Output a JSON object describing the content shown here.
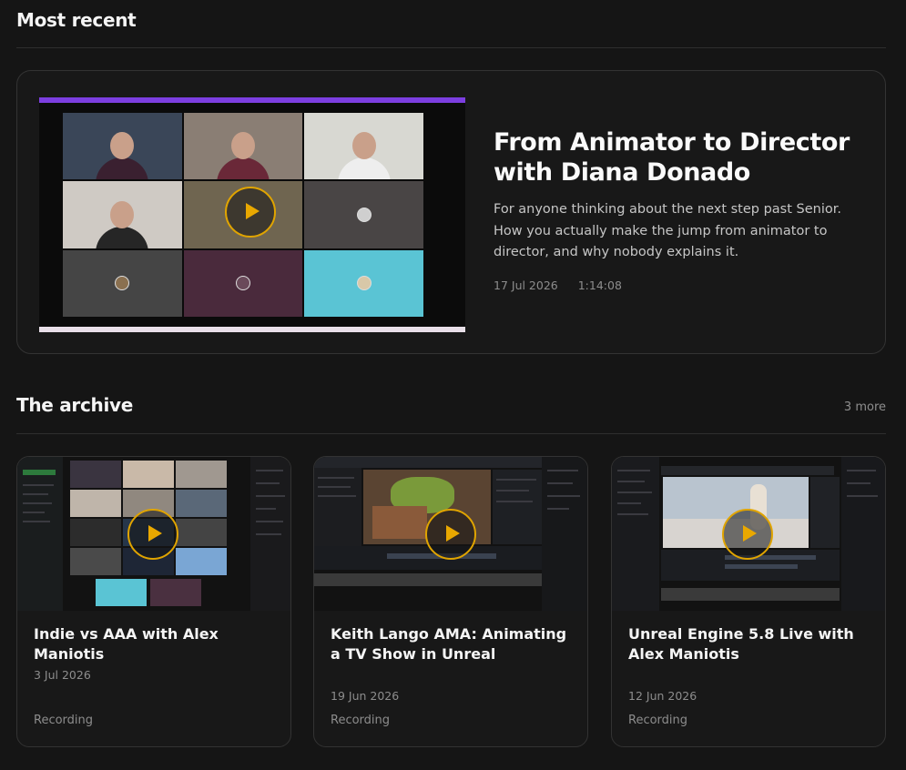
{
  "most_recent": {
    "heading": "Most recent",
    "title": "From Animator to Director with Diana Donado",
    "description": "For anyone thinking about the next step past Senior. How you actually make the jump from animator to director, and why nobody explains it.",
    "date": "17 Jul 2026",
    "duration": "1:14:08"
  },
  "archive": {
    "heading": "The archive",
    "more_label": "3 more",
    "cards": [
      {
        "title": "Indie vs AAA with Alex Maniotis",
        "date": "3 Jul 2026",
        "type": "Recording"
      },
      {
        "title": "Keith Lango AMA: Animating a TV Show in Unreal",
        "date": "19 Jun 2026",
        "type": "Recording"
      },
      {
        "title": "Unreal Engine 5.8 Live with Alex Maniotis",
        "date": "12 Jun 2026",
        "type": "Recording"
      }
    ]
  },
  "icons": {
    "play": "play-icon"
  },
  "colors": {
    "accent": "#e0a400",
    "background": "#151515",
    "card_border": "#333333"
  }
}
